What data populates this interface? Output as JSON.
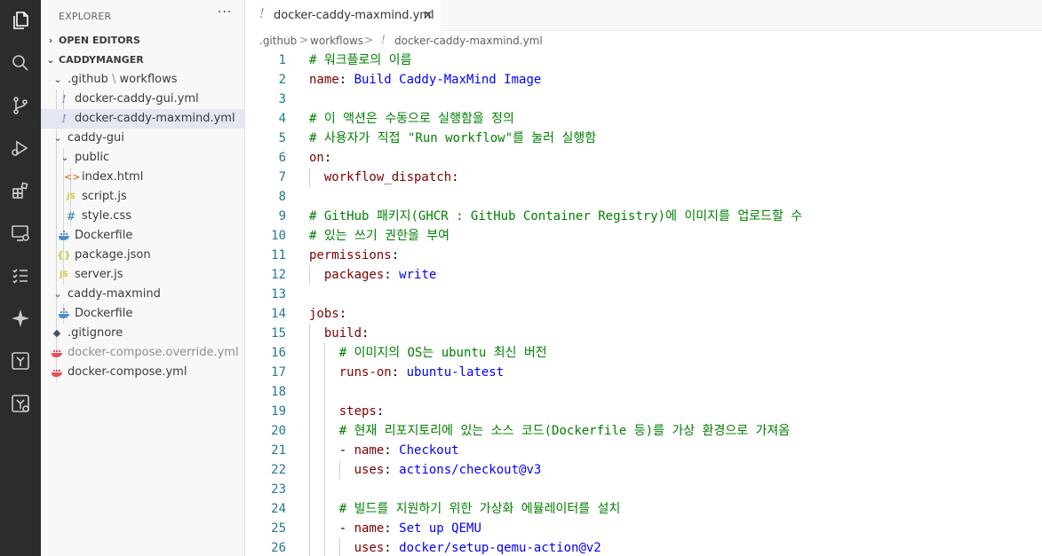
{
  "activity_bar": {
    "icons": [
      "files-icon",
      "search-icon",
      "source-control-icon",
      "run-debug-icon",
      "extensions-icon",
      "remote-explorer-icon",
      "testing-icon",
      "copilot-icon",
      "gitlens-icon",
      "gitlens-inspect-icon"
    ]
  },
  "sidebar": {
    "title": "EXPLORER",
    "more": "···",
    "open_editors": "OPEN EDITORS",
    "workspace": "CADDYMANGER",
    "tree": {
      "github_folder": ".github",
      "github_sub": "workflows",
      "yml_gui": "docker-caddy-gui.yml",
      "yml_maxmind": "docker-caddy-maxmind.yml",
      "caddy_gui": "caddy-gui",
      "public": "public",
      "index_html": "index.html",
      "script_js": "script.js",
      "style_css": "style.css",
      "dockerfile1": "Dockerfile",
      "package_json": "package.json",
      "server_js": "server.js",
      "caddy_maxmind": "caddy-maxmind",
      "dockerfile2": "Dockerfile",
      "gitignore": ".gitignore",
      "compose_override": "docker-compose.override.yml",
      "compose": "docker-compose.yml"
    },
    "icons": {
      "yml": "!",
      "html": "<>",
      "js": "JS",
      "css": "#",
      "json": "{}",
      "gitignore": "◆"
    }
  },
  "tabs": [
    {
      "label": "docker-caddy-maxmind.yml",
      "icon": "!",
      "close": "×"
    }
  ],
  "breadcrumb": {
    "items": [
      ".github",
      "workflows",
      "docker-caddy-maxmind.yml"
    ],
    "separator": ">",
    "icon": "!"
  },
  "editor": {
    "lines": [
      {
        "n": "1",
        "tokens": [
          {
            "t": "# 워크플로의 이름",
            "c": "comment"
          }
        ]
      },
      {
        "n": "2",
        "tokens": [
          {
            "t": "name",
            "c": "key"
          },
          {
            "t": ": ",
            "c": "plain"
          },
          {
            "t": "Build Caddy-MaxMind Image",
            "c": "val"
          }
        ]
      },
      {
        "n": "3",
        "tokens": []
      },
      {
        "n": "4",
        "tokens": [
          {
            "t": "# 이 액션은 수동으로 실행함을 정의",
            "c": "comment"
          }
        ]
      },
      {
        "n": "5",
        "tokens": [
          {
            "t": "# 사용자가 직접 \"Run workflow\"를 눌러 실행함",
            "c": "comment"
          }
        ]
      },
      {
        "n": "6",
        "tokens": [
          {
            "t": "on",
            "c": "key"
          },
          {
            "t": ":",
            "c": "plain"
          }
        ]
      },
      {
        "n": "7",
        "tokens": [
          {
            "t": "  ",
            "c": "plain"
          },
          {
            "t": "workflow_dispatch",
            "c": "key"
          },
          {
            "t": ":",
            "c": "plain"
          }
        ]
      },
      {
        "n": "8",
        "tokens": []
      },
      {
        "n": "9",
        "tokens": [
          {
            "t": "# GitHub 패키지(GHCR : GitHub Container Registry)에 이미지를 업로드할 수",
            "c": "comment"
          }
        ]
      },
      {
        "n": "10",
        "tokens": [
          {
            "t": "# 있는 쓰기 권한을 부여",
            "c": "comment"
          }
        ]
      },
      {
        "n": "11",
        "tokens": [
          {
            "t": "permissions",
            "c": "key"
          },
          {
            "t": ":",
            "c": "plain"
          }
        ]
      },
      {
        "n": "12",
        "tokens": [
          {
            "t": "  ",
            "c": "plain"
          },
          {
            "t": "packages",
            "c": "key"
          },
          {
            "t": ": ",
            "c": "plain"
          },
          {
            "t": "write",
            "c": "val"
          }
        ]
      },
      {
        "n": "13",
        "tokens": []
      },
      {
        "n": "14",
        "tokens": [
          {
            "t": "jobs",
            "c": "key"
          },
          {
            "t": ":",
            "c": "plain"
          }
        ]
      },
      {
        "n": "15",
        "tokens": [
          {
            "t": "  ",
            "c": "plain"
          },
          {
            "t": "build",
            "c": "key"
          },
          {
            "t": ":",
            "c": "plain"
          }
        ]
      },
      {
        "n": "16",
        "tokens": [
          {
            "t": "    ",
            "c": "plain"
          },
          {
            "t": "# 이미지의 OS는 ubuntu 최신 버전",
            "c": "comment"
          }
        ]
      },
      {
        "n": "17",
        "tokens": [
          {
            "t": "    ",
            "c": "plain"
          },
          {
            "t": "runs-on",
            "c": "key"
          },
          {
            "t": ": ",
            "c": "plain"
          },
          {
            "t": "ubuntu-latest",
            "c": "val"
          }
        ]
      },
      {
        "n": "18",
        "tokens": []
      },
      {
        "n": "19",
        "tokens": [
          {
            "t": "    ",
            "c": "plain"
          },
          {
            "t": "steps",
            "c": "key"
          },
          {
            "t": ":",
            "c": "plain"
          }
        ]
      },
      {
        "n": "20",
        "tokens": [
          {
            "t": "    ",
            "c": "plain"
          },
          {
            "t": "# 현재 리포지토리에 있는 소스 코드(Dockerfile 등)를 가상 환경으로 가져옴",
            "c": "comment"
          }
        ]
      },
      {
        "n": "21",
        "tokens": [
          {
            "t": "    ",
            "c": "plain"
          },
          {
            "t": "- ",
            "c": "dash"
          },
          {
            "t": "name",
            "c": "key"
          },
          {
            "t": ": ",
            "c": "plain"
          },
          {
            "t": "Checkout",
            "c": "val"
          }
        ]
      },
      {
        "n": "22",
        "tokens": [
          {
            "t": "      ",
            "c": "plain"
          },
          {
            "t": "uses",
            "c": "key"
          },
          {
            "t": ": ",
            "c": "plain"
          },
          {
            "t": "actions/checkout@v3",
            "c": "val"
          }
        ]
      },
      {
        "n": "23",
        "tokens": []
      },
      {
        "n": "24",
        "tokens": [
          {
            "t": "    ",
            "c": "plain"
          },
          {
            "t": "# 빌드를 지원하기 위한 가상화 에뮬레이터를 설치",
            "c": "comment"
          }
        ]
      },
      {
        "n": "25",
        "tokens": [
          {
            "t": "    ",
            "c": "plain"
          },
          {
            "t": "- ",
            "c": "dash"
          },
          {
            "t": "name",
            "c": "key"
          },
          {
            "t": ": ",
            "c": "plain"
          },
          {
            "t": "Set up QEMU",
            "c": "val"
          }
        ]
      },
      {
        "n": "26",
        "tokens": [
          {
            "t": "      ",
            "c": "plain"
          },
          {
            "t": "uses",
            "c": "key"
          },
          {
            "t": ": ",
            "c": "plain"
          },
          {
            "t": "docker/setup-qemu-action@v2",
            "c": "val"
          }
        ]
      }
    ]
  },
  "colors": {
    "activity_bg": "#2c2c2c",
    "activity_fg": "#cccccc",
    "sidebar_bg": "#f8f8f8",
    "selected_bg": "#e4e6f1",
    "comment": "#008000",
    "key": "#800000",
    "value": "#0000ff",
    "line_number": "#237893",
    "yaml_icon": "#a074c4",
    "docker_icon": "#4e8cd4",
    "compose_icon": "#e0535d"
  }
}
